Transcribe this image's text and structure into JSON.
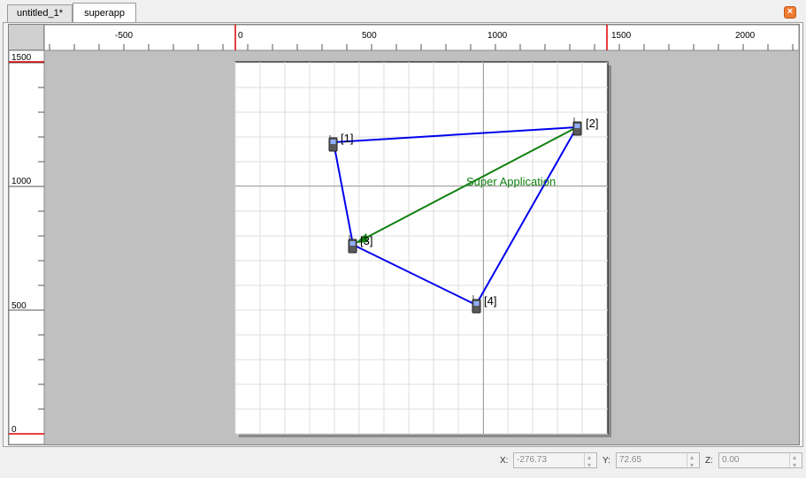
{
  "tabs": [
    {
      "label": "untitled_1*"
    },
    {
      "label": "superapp"
    }
  ],
  "close_icon": "close-icon",
  "rulers": {
    "horizontal": [
      "-500",
      "0",
      "500",
      "1000",
      "1500",
      "2000"
    ],
    "vertical": [
      "1500",
      "1000",
      "500",
      "0"
    ]
  },
  "nodes": [
    {
      "label": "[1]"
    },
    {
      "label": "[2]"
    },
    {
      "label": "[3]"
    },
    {
      "label": "[4]"
    }
  ],
  "application_label": "Super Application",
  "colors": {
    "link": "#0000ee",
    "application": "#108010",
    "ruler_marker": "#dd0000"
  },
  "status": {
    "x_label": "X:",
    "x_value": "-276.73",
    "y_label": "Y:",
    "y_value": "72.65",
    "z_label": "Z:",
    "z_value": "0.00"
  }
}
